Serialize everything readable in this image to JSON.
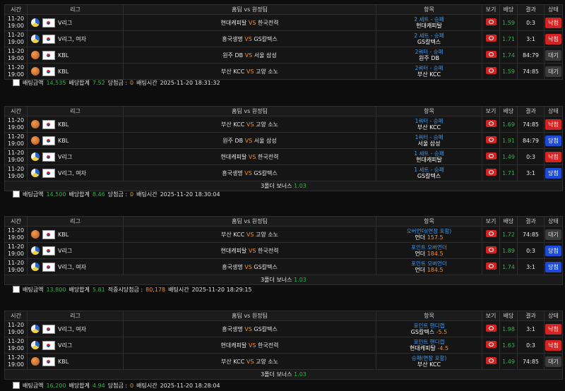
{
  "headers": {
    "time": "시간",
    "league": "리그",
    "match": "홈팀 vs 원정팀",
    "item": "항목",
    "view": "보기",
    "odds": "배당",
    "result": "결과",
    "status": "상태"
  },
  "footer_labels": {
    "amount": "배팅금액",
    "odds_total": "배당합계",
    "win_amount": "당첨금 :",
    "bet_time": "배팅시간",
    "expected": "적중시당첨금 :"
  },
  "bonus_label": "3폴더 보너스",
  "blocks": [
    {
      "rows": [
        {
          "date": "11-20",
          "time": "19:00",
          "sport": "volley",
          "league": "V리그",
          "home": "현대캐피탈",
          "vs": "VS",
          "away": "한국전력",
          "pick_type": "2 세트 - 승패",
          "pick": "현대캐피탈",
          "pick_val": "",
          "odds": "1.59",
          "result": "0:3",
          "status": "낙첨",
          "status_type": "lose"
        },
        {
          "date": "11-20",
          "time": "19:00",
          "sport": "volley",
          "league": "V리그, 여자",
          "home": "흥국생명",
          "vs": "VS",
          "away": "GS칼텍스",
          "pick_type": "2 세트 - 승패",
          "pick": "GS칼텍스",
          "pick_val": "",
          "odds": "1.71",
          "result": "3:1",
          "status": "낙첨",
          "status_type": "lose"
        },
        {
          "date": "11-20",
          "time": "19:00",
          "sport": "basket",
          "league": "KBL",
          "home": "원주 DB",
          "vs": "VS",
          "away": "서울 삼성",
          "pick_type": "2쿼터 - 승패",
          "pick": "원주 DB",
          "pick_val": "",
          "odds": "1.74",
          "result": "84:79",
          "status": "대기",
          "status_type": "wait"
        },
        {
          "date": "11-20",
          "time": "19:00",
          "sport": "basket",
          "league": "KBL",
          "home": "부산 KCC",
          "vs": "VS",
          "away": "고양 소노",
          "pick_type": "2쿼터 - 승패",
          "pick": "부산 KCC",
          "pick_val": "",
          "odds": "1.59",
          "result": "74:85",
          "status": "대기",
          "status_type": "wait"
        }
      ],
      "bonus": "",
      "footer": {
        "amount": "14,535",
        "odds_total": "7.52",
        "win_amount": "0",
        "win_label": "당첨금 :",
        "bet_time": "2025-11-20 18:31:32"
      }
    },
    {
      "rows": [
        {
          "date": "11-20",
          "time": "19:00",
          "sport": "basket",
          "league": "KBL",
          "home": "부산 KCC",
          "vs": "VS",
          "away": "고양 소노",
          "pick_type": "1쿼터 - 승패",
          "pick": "부산 KCC",
          "pick_val": "",
          "odds": "1.69",
          "result": "74:85",
          "status": "낙첨",
          "status_type": "lose"
        },
        {
          "date": "11-20",
          "time": "19:00",
          "sport": "basket",
          "league": "KBL",
          "home": "원주 DB",
          "vs": "VS",
          "away": "서울 삼성",
          "pick_type": "1쿼터 - 승패",
          "pick": "서울 삼성",
          "pick_val": "",
          "odds": "1.91",
          "result": "84:79",
          "status": "당첨",
          "status_type": "win"
        },
        {
          "date": "11-20",
          "time": "19:00",
          "sport": "volley",
          "league": "V리그",
          "home": "현대캐피탈",
          "vs": "VS",
          "away": "한국전력",
          "pick_type": "1 세트 - 승패",
          "pick": "현대캐피탈",
          "pick_val": "",
          "odds": "1.49",
          "result": "0:3",
          "status": "낙첨",
          "status_type": "lose"
        },
        {
          "date": "11-20",
          "time": "19:00",
          "sport": "volley",
          "league": "V리그, 여자",
          "home": "흥국생명",
          "vs": "VS",
          "away": "GS칼텍스",
          "pick_type": "1 세트 - 승패",
          "pick": "GS칼텍스",
          "pick_val": "",
          "odds": "1.71",
          "result": "3:1",
          "status": "당첨",
          "status_type": "win"
        }
      ],
      "bonus": "1.03",
      "footer": {
        "amount": "14,500",
        "odds_total": "8.46",
        "win_amount": "0",
        "win_label": "당첨금 :",
        "bet_time": "2025-11-20 18:30:04"
      }
    },
    {
      "rows": [
        {
          "date": "11-20",
          "time": "19:00",
          "sport": "basket",
          "league": "KBL",
          "home": "부산 KCC",
          "vs": "VS",
          "away": "고양 소노",
          "pick_type": "오버언더(연장 포함)",
          "pick": "언더",
          "pick_val": "157.5",
          "odds": "1.72",
          "result": "74:85",
          "status": "대기",
          "status_type": "wait"
        },
        {
          "date": "11-20",
          "time": "19:00",
          "sport": "volley",
          "league": "V리그",
          "home": "현대캐피탈",
          "vs": "VS",
          "away": "한국전력",
          "pick_type": "포인트 오버언더",
          "pick": "언더",
          "pick_val": "184.5",
          "odds": "1.89",
          "result": "0:3",
          "status": "당첨",
          "status_type": "win"
        },
        {
          "date": "11-20",
          "time": "19:00",
          "sport": "volley",
          "league": "V리그, 여자",
          "home": "흥국생명",
          "vs": "VS",
          "away": "GS칼텍스",
          "pick_type": "포인트 오버언더",
          "pick": "언더",
          "pick_val": "184.5",
          "odds": "1.74",
          "result": "3:1",
          "status": "당첨",
          "status_type": "win"
        }
      ],
      "bonus": "1.03",
      "footer": {
        "amount": "13,800",
        "odds_total": "5.81",
        "win_amount": "80,178",
        "win_label": "적중시당첨금 :",
        "bet_time": "2025-11-20 18:29:15"
      }
    },
    {
      "rows": [
        {
          "date": "11-20",
          "time": "19:00",
          "sport": "volley",
          "league": "V리그, 여자",
          "home": "흥국생명",
          "vs": "VS",
          "away": "GS칼텍스",
          "pick_type": "포인트 핸디캡",
          "pick": "GS칼텍스",
          "pick_val": "-5.5",
          "odds": "1.98",
          "result": "3:1",
          "status": "낙첨",
          "status_type": "lose"
        },
        {
          "date": "11-20",
          "time": "19:00",
          "sport": "volley",
          "league": "V리그",
          "home": "현대캐피탈",
          "vs": "VS",
          "away": "한국전력",
          "pick_type": "포인트 핸디캡",
          "pick": "현대캐피탈",
          "pick_val": "-4.5",
          "odds": "1.63",
          "result": "0:3",
          "status": "낙첨",
          "status_type": "lose"
        },
        {
          "date": "11-20",
          "time": "19:00",
          "sport": "basket",
          "league": "KBL",
          "home": "부산 KCC",
          "vs": "VS",
          "away": "고양 소노",
          "pick_type": "승패(연장 포함)",
          "pick": "부산 KCC",
          "pick_val": "",
          "odds": "1.49",
          "result": "74:85",
          "status": "대기",
          "status_type": "wait"
        }
      ],
      "bonus": "1.03",
      "footer": {
        "amount": "16,200",
        "odds_total": "4.94",
        "win_amount": "0",
        "win_label": "당첨금 :",
        "bet_time": "2025-11-20 18:28:04"
      }
    }
  ]
}
